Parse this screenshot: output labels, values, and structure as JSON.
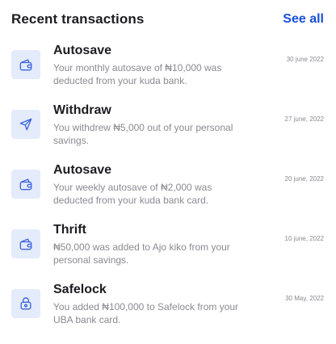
{
  "header": {
    "title": "Recent transactions",
    "see_all_label": "See all"
  },
  "transactions": [
    {
      "title": "Autosave",
      "description": "Your monthly autosave of ₦10,000 was deducted from your kuda bank.",
      "date": "30 june 2022",
      "icon": "wallet-icon"
    },
    {
      "title": "Withdraw",
      "description": "You withdrew ₦5,000 out of your personal savings.",
      "date": "27 june, 2022",
      "icon": "send-icon"
    },
    {
      "title": "Autosave",
      "description": "Your weekly autosave of ₦2,000 was deducted from your kuda bank card.",
      "date": "20 june, 2022",
      "icon": "wallet-icon"
    },
    {
      "title": "Thrift",
      "description": "₦50,000 was added to Ajo kiko from your personal savings.",
      "date": "10 june, 2022",
      "icon": "wallet-icon"
    },
    {
      "title": "Safelock",
      "description": "You added ₦100,000 to Safelock from your UBA bank card.",
      "date": "30 May, 2022",
      "icon": "lock-icon"
    }
  ],
  "colors": {
    "accent": "#1a4fd6",
    "icon_bg": "#e4ebfb",
    "icon_stroke": "#3d63dd",
    "muted_text": "#8a8a92"
  }
}
